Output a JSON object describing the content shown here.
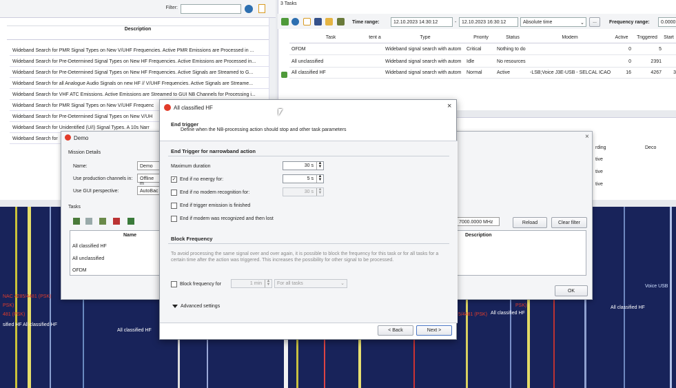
{
  "left_panel": {
    "filter_label": "Filter:",
    "filter_value": "",
    "column_header": "Description",
    "rows": [
      "Wideband Search for PMR Signal Types on New V/UHF Frequencies. Active PMR Emissions are Processed in ...",
      "Wideband Search for Pre-Determined Signal Types on New HF Frequencies. Active Emissions are Processed in...",
      "Wideband Search for Pre-Determined Signal Types on New HF Frequencies. Active Signals are Streamed to G...",
      "Wideband Search for all Analogue Audio Signals on new HF // V/UHF Frequencies. Active Signals are Streame...",
      "Wideband Search for VHF ATC Emissions. Active Emissions are Streamed to GUI NB Channels for Processing i...",
      "Wideband Search for PMR Signal Types on New V/UHF Frequenc",
      "Wideband Search for Pre-Determined Signal Types on New V/UH",
      "Wideband Search for Unidentified (U/I) Signal Types. A 10s Narr",
      "Wideband Search for"
    ]
  },
  "tasks_panel": {
    "title": "3 Tasks",
    "time_range_label": "Time range:",
    "time_from": "12.10.2023 14:30:12",
    "time_sep": "-",
    "time_to": "12.10.2023 16:30:12",
    "time_mode": "Absolute time",
    "more_button": "...",
    "freq_range_label": "Frequency range:",
    "freq_from": "0.0000",
    "columns": [
      "Task",
      "tent a",
      "Type",
      "Priority",
      "Status",
      "Modem",
      "Active",
      "Triggered",
      "Start"
    ],
    "rows": [
      {
        "task": "OFDM",
        "tent": "",
        "type": "Wideband signal search with autom",
        "priority": "Critical",
        "status": "Nothing to do",
        "modem": "",
        "active": "0",
        "triggered": "5",
        "start": ""
      },
      {
        "task": "All unclassified",
        "tent": "",
        "type": "Wideband signal search with autom",
        "priority": "Idle",
        "status": "No resources",
        "modem": "",
        "active": "0",
        "triggered": "2391",
        "start": ""
      },
      {
        "task": "All classified HF",
        "tent": "",
        "type": "Wideband signal search with autom",
        "priority": "Normal",
        "status": "Active",
        "modem": "-LSB;Voice J3E-USB - SELCAL ICAO",
        "active": "16",
        "triggered": "4267",
        "start": "3"
      }
    ]
  },
  "mid_panel": {
    "col_recording": "rding",
    "col_deco": "Deco",
    "rows": [
      "tive",
      "tive",
      "tive"
    ]
  },
  "demo_dialog": {
    "title": "Demo",
    "close": "×",
    "mission_details": "Mission Details",
    "name_label": "Name:",
    "name_value": "Demo",
    "prod_channels_label": "Use production channels in:",
    "prod_channels_value": "Offline m",
    "gui_perspective_label": "Use GUI perspective:",
    "gui_perspective_value": "AutoBac",
    "tasks_label": "Tasks",
    "freq_value": "7000.0000 MHz",
    "reload_button": "Reload",
    "clear_filter_button": "Clear filter",
    "table_name_header": "Name",
    "table_desc_header": "Description",
    "task_rows": [
      "All classified HF",
      "All unclassified",
      "OFDM"
    ],
    "ok_button": "OK"
  },
  "main_dialog": {
    "title": "All classified HF",
    "close": "×",
    "header_title": "End trigger",
    "header_subtitle": "Define when the NB-processing action should stop and other task parameters",
    "section1": "End Trigger for narrowband action",
    "max_duration_label": "Maximum duration",
    "max_duration_value": "30 s",
    "no_energy_label": "End if no energy for:",
    "no_energy_checked": true,
    "no_energy_value": "5 s",
    "no_modem_label": "End if no modem recognition for:",
    "no_modem_checked": false,
    "no_modem_value": "30 s",
    "trigger_finished_label": "End if trigger emission is finished",
    "modem_recognized_label": "End if modem was recognized and then lost",
    "section2": "Block Frequency",
    "block_description": "To avoid processing the same signal over and over again, it is possible to block the frequency for this task or for all tasks for a certain time after the action was triggered. This increases the possibility for other signal to be processed.",
    "block_freq_label": "Block frequency for",
    "block_freq_value": "1 min",
    "block_scope_value": "For all tasks",
    "advanced_label": "Advanced settings",
    "back_button": "< Back",
    "next_button": "Next >"
  },
  "spectrum_labels": {
    "l1": "NAC 4285/4481 (PSK)",
    "l2": "PSK)",
    "l3": "481 (PSK)",
    "l4": "sified HF   All classified HF",
    "l5": "All classified HF",
    "l6": "5/4481 (PSK)",
    "l7": "All classified HF",
    "l8": "PSK)",
    "l9": "All classified HF",
    "l10": "Voice USB"
  },
  "colors": {
    "accent_red": "#e23c2a",
    "spectrum_bg": "#18235a",
    "dialog_bg": "#ffffff"
  }
}
